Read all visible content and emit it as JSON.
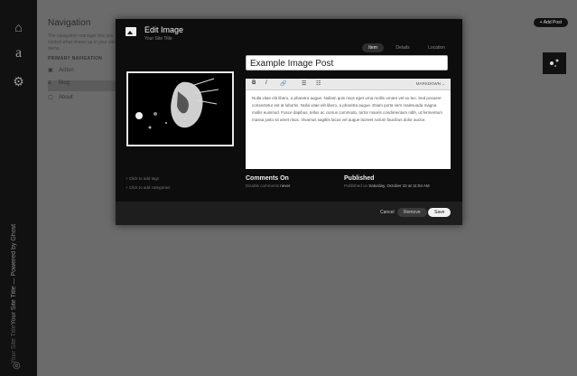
{
  "rail": {
    "icons": [
      "home-icon",
      "a-icon",
      "gear-icon"
    ],
    "site_title": "Your Site Title",
    "site_sub": "Your Site Title — Powered by Ghost",
    "bottom_logo": "logo-icon"
  },
  "app": {
    "title": "Navigation",
    "description": "The navigation manager lets you control what shows up in your site's menu.",
    "section_label": "PRIMARY NAVIGATION",
    "items": [
      {
        "icon": "image-icon",
        "label": "Action"
      },
      {
        "icon": "a-icon",
        "label": "Blog"
      },
      {
        "icon": "page-icon",
        "label": "About"
      }
    ],
    "add_button": "+ Add Post"
  },
  "modal": {
    "title": "Edit Image",
    "subtitle": "Your Site Title",
    "tabs": [
      {
        "label": "Item",
        "active": true
      },
      {
        "label": "Details",
        "active": false
      },
      {
        "label": "Location",
        "active": false
      }
    ],
    "post_title": "Example Image Post",
    "toolbar": {
      "bold": "B",
      "italic": "I",
      "link": "🔗",
      "ul": "☰",
      "ol": "☷",
      "markdown": "MARKDOWN ⌄"
    },
    "body": "Nulla vitae elit libero, a pharetra augue. Nullam quis risus eget urna mollis ornare vel eu leo. Sed posuere consectetur est at lobortis. Nulla vitae elit libero, a pharetra augue. Etiam porta sem malesuada magna mollis euismod. Fusce dapibus, tellus ac cursus commodo, tortor mauris condimentum nibh, ut fermentum massa justo sit amet risus. Vivamus sagittis lacus vel augue laoreet rutrum faucibus dolor auctor.",
    "left_links": [
      "+ Click to add tags",
      "+ Click to add categories"
    ],
    "comments_heading": "Comments On",
    "comments_sub": "Disable comments",
    "comments_link": "never",
    "published_heading": "Published",
    "published_sub": "Published on",
    "published_date": "Saturday, October 22 at 11:04 AM",
    "buttons": {
      "cancel": "Cancel",
      "remove": "Remove",
      "save": "Save"
    }
  }
}
